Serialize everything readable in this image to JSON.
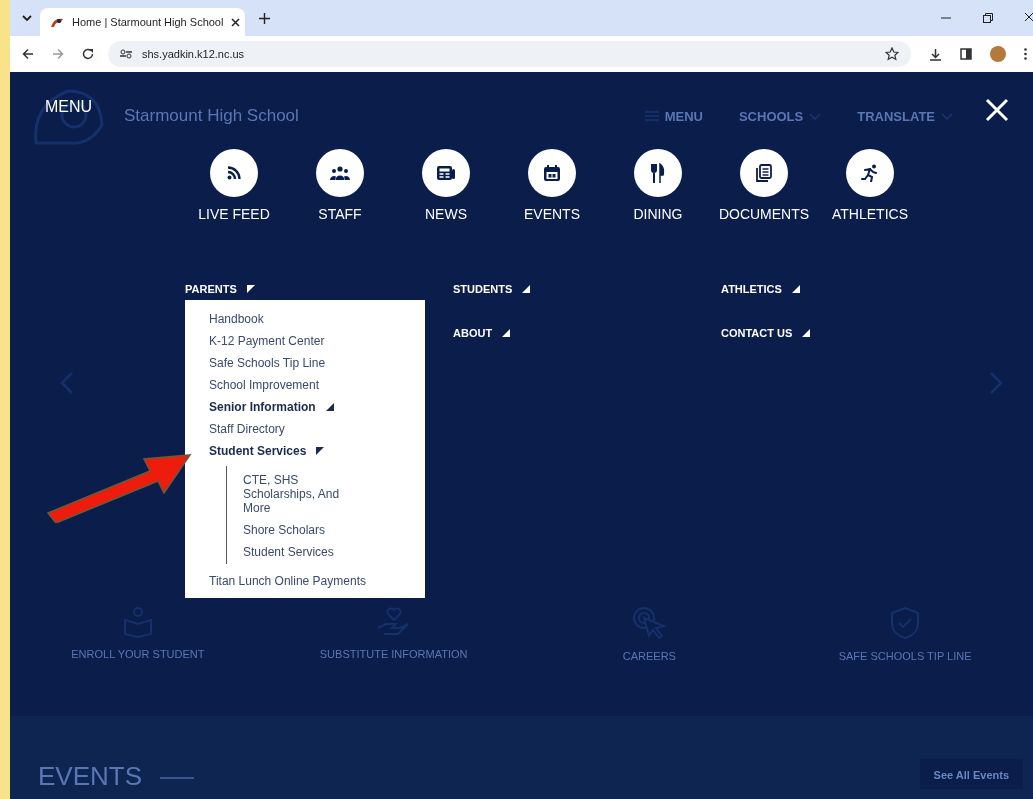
{
  "browser": {
    "tabs": [
      {
        "title": "Home | Starmount High School",
        "selected": true
      }
    ],
    "url": "shs.yadkin.k12.nc.us"
  },
  "background_page": {
    "school_name": "Starmount High School",
    "header_links": [
      {
        "label": "MENU",
        "kind": "menu"
      },
      {
        "label": "SCHOOLS",
        "kind": "dropdown"
      },
      {
        "label": "TRANSLATE",
        "kind": "dropdown"
      }
    ],
    "quick_links": [
      {
        "label": "ENROLL YOUR STUDENT",
        "kind": "reader"
      },
      {
        "label": "SUBSTITUTE INFORMATION",
        "kind": "hand"
      },
      {
        "label": "CAREERS",
        "kind": "click"
      },
      {
        "label": "SAFE SCHOOLS TIP LINE",
        "kind": "shield"
      }
    ],
    "events": {
      "heading": "EVENTS",
      "button": "See All Events"
    }
  },
  "menu": {
    "title": "MENU",
    "icon_links": [
      {
        "label": "LIVE FEED",
        "kind": "rss"
      },
      {
        "label": "STAFF",
        "kind": "people"
      },
      {
        "label": "NEWS",
        "kind": "news"
      },
      {
        "label": "EVENTS",
        "kind": "calendar"
      },
      {
        "label": "DINING",
        "kind": "dining"
      },
      {
        "label": "DOCUMENTS",
        "kind": "document"
      },
      {
        "label": "ATHLETICS",
        "kind": "runner"
      }
    ],
    "columns": [
      {
        "sections": [
          {
            "label": "PARENTS",
            "expanded": true,
            "items": [
              {
                "label": "Handbook"
              },
              {
                "label": "K-12 Payment Center"
              },
              {
                "label": "Safe Schools Tip Line"
              },
              {
                "label": "School Improvement"
              },
              {
                "label": "Senior Information",
                "expanded": false
              },
              {
                "label": "Staff Directory"
              },
              {
                "label": "Student Services",
                "expanded": true,
                "children": [
                  {
                    "label": "CTE, SHS Scholarships, And More"
                  },
                  {
                    "label": "Shore Scholars"
                  },
                  {
                    "label": "Student Services"
                  }
                ]
              },
              {
                "label": "Titan Lunch Online Payments"
              }
            ]
          }
        ]
      },
      {
        "sections": [
          {
            "label": "STUDENTS",
            "expanded": false
          },
          {
            "label": "ABOUT",
            "expanded": false
          }
        ]
      },
      {
        "sections": [
          {
            "label": "ATHLETICS",
            "expanded": false
          },
          {
            "label": "CONTACT US",
            "expanded": false
          }
        ]
      }
    ]
  }
}
